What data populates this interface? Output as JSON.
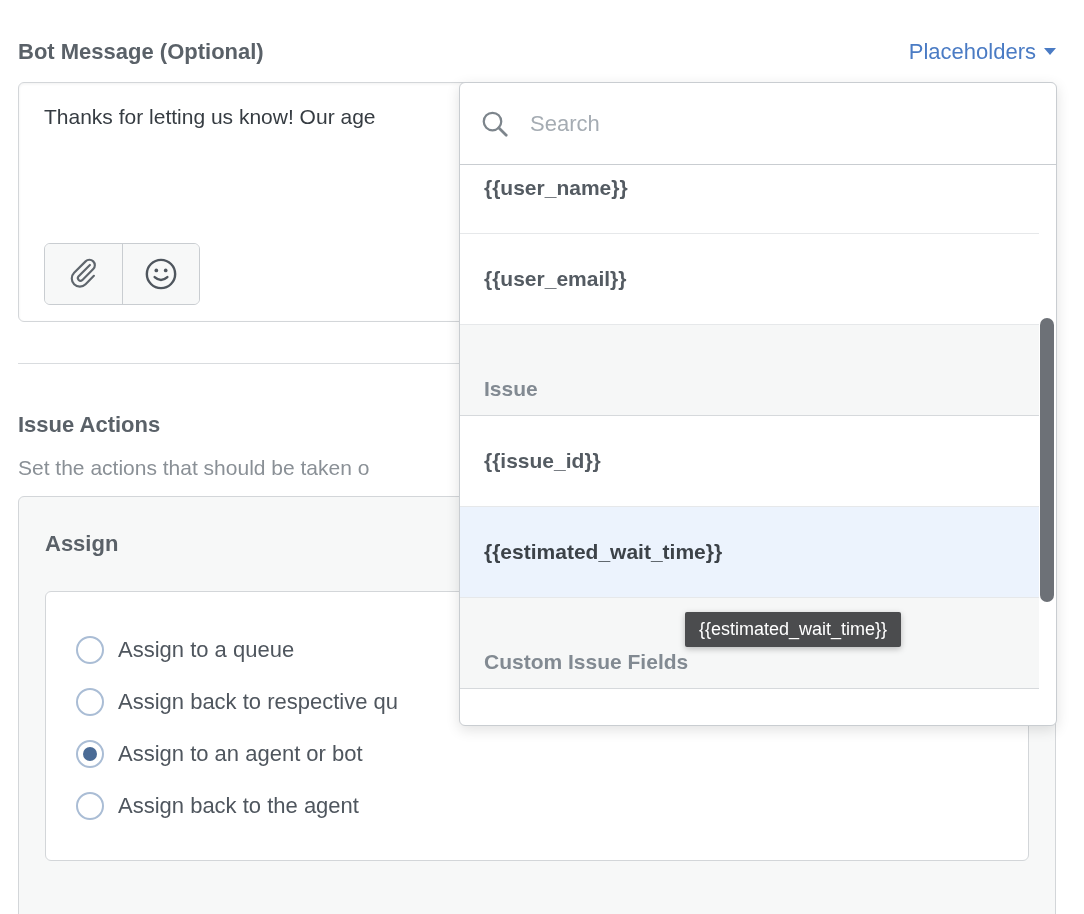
{
  "bot_message": {
    "label": "Bot Message (Optional)",
    "placeholders_button": "Placeholders",
    "value": "Thanks for letting us know! Our age"
  },
  "placeholder_menu": {
    "search_placeholder": "Search",
    "items": [
      {
        "kind": "item",
        "label": "{{user_name}}",
        "selected": false
      },
      {
        "kind": "item",
        "label": "{{user_email}}",
        "selected": false
      },
      {
        "kind": "header",
        "label": "Issue"
      },
      {
        "kind": "item",
        "label": "{{issue_id}}",
        "selected": false
      },
      {
        "kind": "item",
        "label": "{{estimated_wait_time}}",
        "selected": true
      },
      {
        "kind": "header",
        "label": "Custom Issue Fields"
      }
    ],
    "tooltip": "{{estimated_wait_time}}"
  },
  "issue_actions": {
    "title": "Issue Actions",
    "description": "Set the actions that should be taken o",
    "assign": {
      "title": "Assign",
      "options": [
        {
          "label": "Assign to a queue",
          "selected": false
        },
        {
          "label": "Assign back to respective qu",
          "selected": false
        },
        {
          "label": "Assign to an agent or bot",
          "selected": true
        },
        {
          "label": "Assign back to the agent",
          "selected": false
        }
      ]
    }
  }
}
